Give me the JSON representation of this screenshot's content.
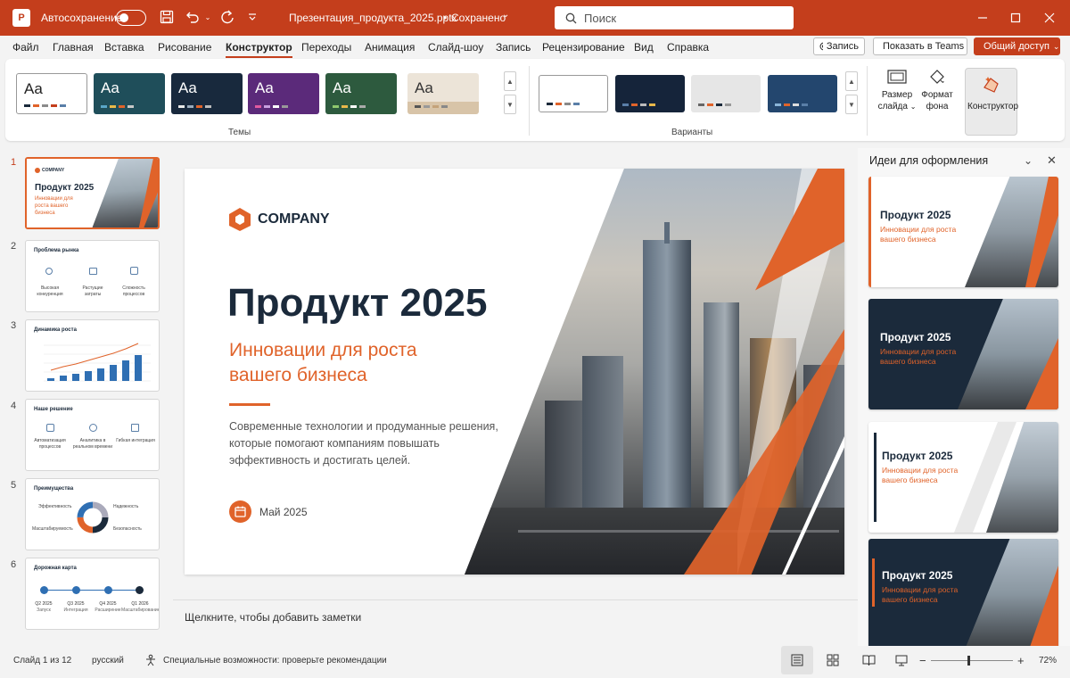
{
  "window": {
    "app_icon": "P",
    "autosave_label": "Автосохранение",
    "file_title": "Презентация_продукта_2025.pptx",
    "save_status": "Сохранено",
    "search_placeholder": "Поиск"
  },
  "menu": {
    "tabs": [
      "Файл",
      "Главная",
      "Вставка",
      "Рисование",
      "Конструктор",
      "Переходы",
      "Анимация",
      "Слайд-шоу",
      "Запись",
      "Рецензирование",
      "Вид",
      "Справка"
    ],
    "active_tab": "Конструктор",
    "record_btn": "Запись",
    "teams_btn": "Показать в Teams",
    "share_btn": "Общий доступ"
  },
  "ribbon": {
    "themes_label": "Темы",
    "variants_label": "Варианты",
    "theme_sample": "Aa",
    "slide_size_label": "Размер слайда",
    "format_bg_label": "Формат фона",
    "designer_label": "Конструктор"
  },
  "thumbnails": [
    {
      "num": "1",
      "title": "Продукт 2025",
      "subtitle": "Инновации для роста вашего бизнеса",
      "logo": "COMPANY"
    },
    {
      "num": "2",
      "title": "Проблема рынка",
      "items": [
        "Высокая конкуренция",
        "Растущие затраты",
        "Сложность процессов"
      ]
    },
    {
      "num": "3",
      "title": "Динамика роста"
    },
    {
      "num": "4",
      "title": "Наше решение",
      "items": [
        "Автоматизация процессов",
        "Аналитика в реальном времени",
        "Гибкая интеграция"
      ]
    },
    {
      "num": "5",
      "title": "Преимущества",
      "items": [
        "Эффективность",
        "Надежность",
        "Масштабируемость",
        "Безопасность"
      ]
    },
    {
      "num": "6",
      "title": "Дорожная карта",
      "milestones": [
        {
          "q": "Q2 2025",
          "t": "Запуск"
        },
        {
          "q": "Q3 2025",
          "t": "Интеграция"
        },
        {
          "q": "Q4 2025",
          "t": "Расширение"
        },
        {
          "q": "Q1 2026",
          "t": "Масштабирование"
        }
      ]
    }
  ],
  "slide": {
    "logo": "COMPANY",
    "title": "Продукт 2025",
    "subtitle_line1": "Инновации для роста",
    "subtitle_line2": "вашего бизнеса",
    "body_line1": "Современные технологии и продуманные решения,",
    "body_line2": "которые помогают компаниям повышать",
    "body_line3": "эффективность и достигать целей.",
    "date": "Май 2025"
  },
  "notes_placeholder": "Щелкните, чтобы добавить заметки",
  "designer": {
    "title": "Идеи для оформления",
    "ideas": [
      {
        "title": "Продукт 2025",
        "subtitle_line1": "Инновации для роста",
        "subtitle_line2": "вашего бизнеса"
      },
      {
        "title": "Продукт 2025",
        "subtitle_line1": "Инновации для роста",
        "subtitle_line2": "вашего бизнеса"
      },
      {
        "title": "Продукт 2025",
        "subtitle_line1": "Инновации для роста",
        "subtitle_line2": "вашего бизнеса"
      },
      {
        "title": "Продукт 2025",
        "subtitle_line1": "Инновации для роста",
        "subtitle_line2": "вашего бизнеса"
      }
    ]
  },
  "status": {
    "slide_info": "Слайд 1 из 12",
    "language": "русский",
    "accessibility": "Специальные возможности: проверьте рекомендации",
    "zoom": "72%"
  },
  "colors": {
    "accent": "#c43e1c",
    "orange": "#e0632a",
    "navy": "#1b2a3b"
  }
}
